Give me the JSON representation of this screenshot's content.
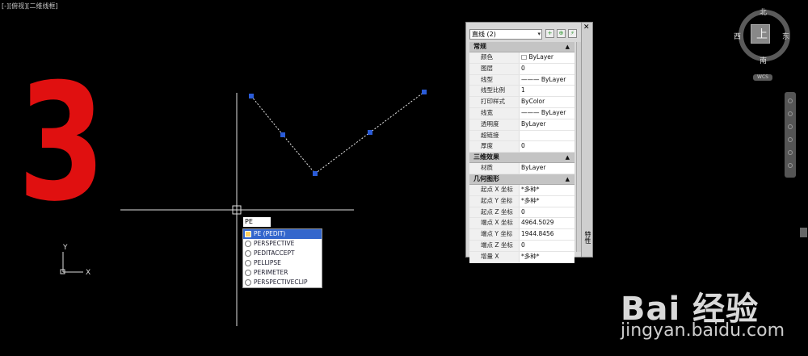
{
  "viewport": {
    "label": "[-][俯视][二维线框]"
  },
  "annotation": {
    "step_number": "3"
  },
  "command": {
    "input_text": "PE",
    "autocomplete": [
      {
        "label": "PE (PEDIT)",
        "selected": true
      },
      {
        "label": "PERSPECTIVE",
        "selected": false
      },
      {
        "label": "PEDITACCEPT",
        "selected": false
      },
      {
        "label": "PELLIPSE",
        "selected": false
      },
      {
        "label": "PERIMETER",
        "selected": false
      },
      {
        "label": "PERSPECTIVECLIP",
        "selected": false
      }
    ]
  },
  "ucs": {
    "y_label": "Y",
    "x_label": "X"
  },
  "properties": {
    "selection": "直线 (2)",
    "sections": [
      {
        "title": "常规",
        "rows": [
          {
            "key": "颜色",
            "value": "□ ByLayer"
          },
          {
            "key": "图层",
            "value": "0"
          },
          {
            "key": "线型",
            "value": "——— ByLayer"
          },
          {
            "key": "线型比例",
            "value": "1"
          },
          {
            "key": "打印样式",
            "value": "ByColor"
          },
          {
            "key": "线宽",
            "value": "——— ByLayer"
          },
          {
            "key": "透明度",
            "value": "ByLayer"
          },
          {
            "key": "超链接",
            "value": ""
          },
          {
            "key": "厚度",
            "value": "0"
          }
        ]
      },
      {
        "title": "三维效果",
        "rows": [
          {
            "key": "材质",
            "value": "ByLayer"
          }
        ]
      },
      {
        "title": "几何图形",
        "rows": [
          {
            "key": "起点 X 坐标",
            "value": "*多种*"
          },
          {
            "key": "起点 Y 坐标",
            "value": "*多种*"
          },
          {
            "key": "起点 Z 坐标",
            "value": "0"
          },
          {
            "key": "端点 X 坐标",
            "value": "4964.5029"
          },
          {
            "key": "端点 Y 坐标",
            "value": "1944.8456"
          },
          {
            "key": "端点 Z 坐标",
            "value": "0"
          },
          {
            "key": "增量 X",
            "value": "*多种*"
          }
        ]
      }
    ],
    "palette_title": "特性",
    "close_glyph": "✕"
  },
  "viewcube": {
    "north": "北",
    "south": "南",
    "east": "东",
    "west": "西",
    "top": "上",
    "wcs": "WCS"
  },
  "watermark": {
    "brand": "Bai 经验",
    "url": "jingyan.baidu.com"
  },
  "colors": {
    "background": "#000000",
    "step_number": "#e01010",
    "grip": "#2a5bd7",
    "selection_highlight": "#3366cc"
  }
}
